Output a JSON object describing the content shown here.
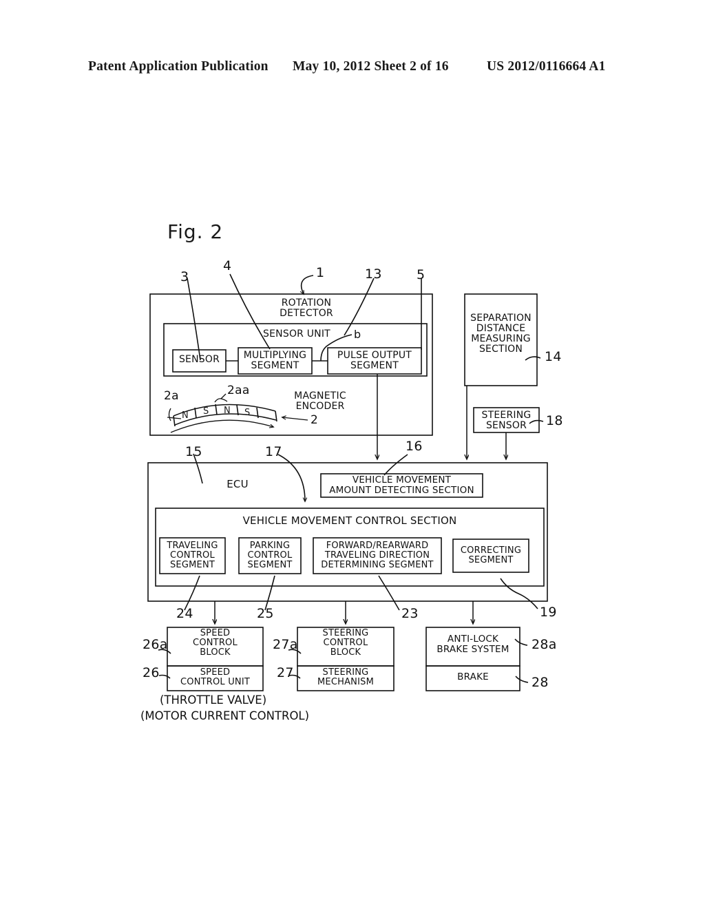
{
  "header": {
    "publication": "Patent Application Publication",
    "date_sheet": "May 10, 2012  Sheet 2 of 16",
    "patent_number": "US 2012/0116664 A1"
  },
  "figure": {
    "label": "Fig. 2"
  },
  "blocks": {
    "rotation_detector": "ROTATION\nDETECTOR",
    "sensor_unit": "SENSOR UNIT",
    "sensor": "SENSOR",
    "multiplying_segment": "MULTIPLYING\nSEGMENT",
    "pulse_output_segment": "PULSE OUTPUT\nSEGMENT",
    "magnetic_encoder": "MAGNETIC\nENCODER",
    "separation_distance": "SEPARATION\nDISTANCE\nMEASURING\nSECTION",
    "steering_sensor": "STEERING\nSENSOR",
    "ecu": "ECU",
    "vehicle_movement_amount": "VEHICLE MOVEMENT\nAMOUNT DETECTING SECTION",
    "vehicle_movement_control": "VEHICLE MOVEMENT CONTROL SECTION",
    "traveling_control_segment": "TRAVELING\nCONTROL\nSEGMENT",
    "parking_control_segment": "PARKING\nCONTROL\nSEGMENT",
    "forward_rearward_segment": "FORWARD/REARWARD\nTRAVELING DIRECTION\nDETERMINING SEGMENT",
    "correcting_segment": "CORRECTING\nSEGMENT",
    "speed_control_block": "SPEED\nCONTROL\nBLOCK",
    "speed_control_unit": "SPEED\nCONTROL UNIT",
    "steering_control_block": "STEERING\nCONTROL\nBLOCK",
    "steering_mechanism": "STEERING\nMECHANISM",
    "anti_lock_brake_system": "ANTI-LOCK\nBRAKE SYSTEM",
    "brake": "BRAKE"
  },
  "notes": {
    "throttle_valve": "(THROTTLE VALVE)",
    "motor_current_control": "(MOTOR CURRENT CONTROL)"
  },
  "encoder": {
    "poles": [
      "N",
      "S",
      "N",
      "S"
    ],
    "label_2a": "2a",
    "label_2aa": "2aa",
    "label_2": "2"
  },
  "ref_numerals": {
    "n1": "1",
    "n2": "2",
    "n3": "3",
    "n4": "4",
    "n5": "5",
    "nb": "b",
    "n13": "13",
    "n14": "14",
    "n15": "15",
    "n16": "16",
    "n17": "17",
    "n18": "18",
    "n19": "19",
    "n23": "23",
    "n24": "24",
    "n25": "25",
    "n26": "26",
    "n26a": "26a",
    "n27": "27",
    "n27a": "27a",
    "n28": "28",
    "n28a": "28a"
  },
  "colors": {
    "ink": "#111111",
    "paper": "#ffffff"
  }
}
